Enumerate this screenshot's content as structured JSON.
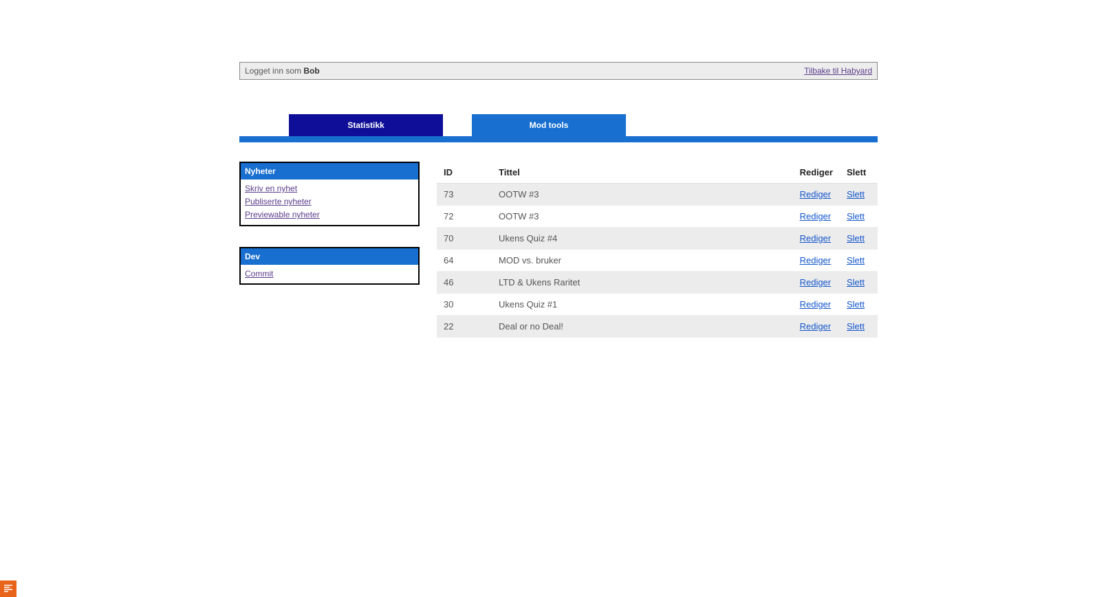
{
  "topbar": {
    "login_prefix": "Logget inn som ",
    "username": "Bob",
    "back_link": "Tilbake til Habyard"
  },
  "tabs": {
    "statistikk": "Statistikk",
    "modtools": "Mod tools"
  },
  "sidebar": {
    "nyheter": {
      "title": "Nyheter",
      "links": {
        "skriv": "Skriv en nyhet",
        "publiserte": "Publiserte nyheter",
        "previewable": "Previewable nyheter"
      }
    },
    "dev": {
      "title": "Dev",
      "links": {
        "commit": "Commit"
      }
    }
  },
  "table": {
    "headers": {
      "id": "ID",
      "tittel": "Tittel",
      "rediger": "Rediger",
      "slett": "Slett"
    },
    "labels": {
      "rediger": "Rediger",
      "slett": "Slett"
    },
    "rows": [
      {
        "id": "73",
        "tittel": "OOTW #3"
      },
      {
        "id": "72",
        "tittel": "OOTW #3"
      },
      {
        "id": "70",
        "tittel": "Ukens Quiz #4"
      },
      {
        "id": "64",
        "tittel": "MOD vs. bruker"
      },
      {
        "id": "46",
        "tittel": "LTD & Ukens Raritet"
      },
      {
        "id": "30",
        "tittel": "Ukens Quiz #1"
      },
      {
        "id": "22",
        "tittel": "Deal or no Deal!"
      }
    ]
  }
}
